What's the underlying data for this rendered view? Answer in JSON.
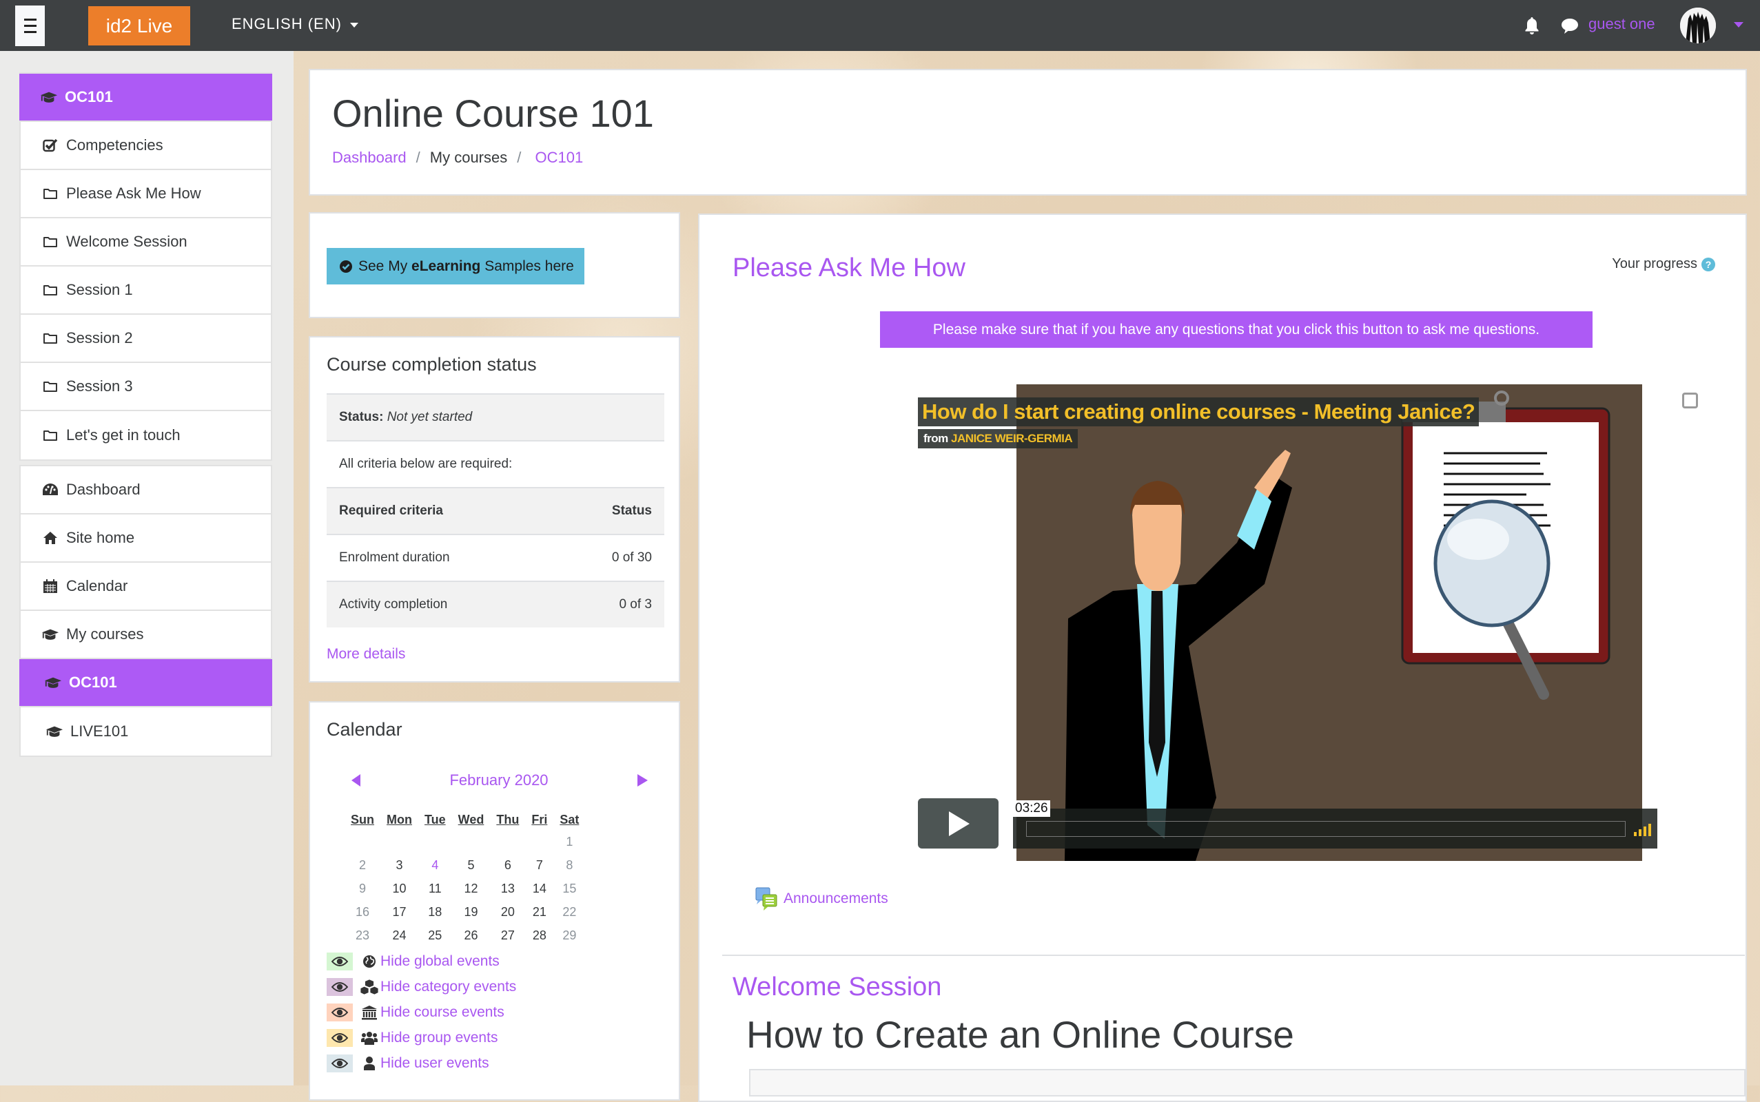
{
  "navbar": {
    "brand": "id2 Live",
    "language": "ENGLISH (EN)",
    "username": "guest one",
    "icons": [
      "menu-icon",
      "bell-icon",
      "chat-icon",
      "caret-down-icon"
    ]
  },
  "sidebar": {
    "course_nav": [
      {
        "label": "OC101",
        "icon": "graduation-cap-icon",
        "active": true
      },
      {
        "label": "Competencies",
        "icon": "checkbox-icon"
      },
      {
        "label": "Please Ask Me How",
        "icon": "folder-icon"
      },
      {
        "label": "Welcome Session",
        "icon": "folder-icon"
      },
      {
        "label": "Session 1",
        "icon": "folder-icon"
      },
      {
        "label": "Session 2",
        "icon": "folder-icon"
      },
      {
        "label": "Session 3",
        "icon": "folder-icon"
      },
      {
        "label": "Let's get in touch",
        "icon": "folder-icon"
      }
    ],
    "site_nav": [
      {
        "label": "Dashboard",
        "icon": "dashboard-icon"
      },
      {
        "label": "Site home",
        "icon": "home-icon"
      },
      {
        "label": "Calendar",
        "icon": "calendar-icon"
      },
      {
        "label": "My courses",
        "icon": "graduation-cap-icon"
      },
      {
        "label": "OC101",
        "icon": "graduation-cap-icon",
        "active": true
      },
      {
        "label": "LIVE101",
        "icon": "graduation-cap-icon"
      }
    ]
  },
  "header": {
    "title": "Online Course 101",
    "breadcrumb": [
      {
        "label": "Dashboard",
        "link": true
      },
      {
        "label": "My courses",
        "link": false
      },
      {
        "label": "OC101",
        "link": true
      }
    ]
  },
  "samples_block": {
    "button_prefix": "See My ",
    "button_bold": "eLearning",
    "button_suffix": " Samples here"
  },
  "completion": {
    "title": "Course completion status",
    "status_label": "Status:",
    "status_value": "Not yet started",
    "note": "All criteria below are required:",
    "col_criteria": "Required criteria",
    "col_status": "Status",
    "rows": [
      {
        "criteria": "Enrolment duration",
        "status": "0 of 30"
      },
      {
        "criteria": "Activity completion",
        "status": "0 of 3"
      }
    ],
    "more": "More details"
  },
  "calendar": {
    "title": "Calendar",
    "month": "February 2020",
    "weekdays": [
      "Sun",
      "Mon",
      "Tue",
      "Wed",
      "Thu",
      "Fri",
      "Sat"
    ],
    "weeks": [
      [
        "",
        "",
        "",
        "",
        "",
        "",
        "1"
      ],
      [
        "2",
        "3",
        "4",
        "5",
        "6",
        "7",
        "8"
      ],
      [
        "9",
        "10",
        "11",
        "12",
        "13",
        "14",
        "15"
      ],
      [
        "16",
        "17",
        "18",
        "19",
        "20",
        "21",
        "22"
      ],
      [
        "23",
        "24",
        "25",
        "26",
        "27",
        "28",
        "29"
      ]
    ],
    "today": "4",
    "event_filters": [
      {
        "label": "Hide global events",
        "icon": "globe-icon",
        "color": "#d5f6d2"
      },
      {
        "label": "Hide category events",
        "icon": "cubes-icon",
        "color": "#dbc3dd"
      },
      {
        "label": "Hide course events",
        "icon": "institution-icon",
        "color": "#ffd3bd"
      },
      {
        "label": "Hide group events",
        "icon": "group-icon",
        "color": "#fee7ae"
      },
      {
        "label": "Hide user events",
        "icon": "user-icon",
        "color": "#dce7ec"
      }
    ]
  },
  "main": {
    "section1_title": "Please Ask Me How",
    "progress_label": "Your progress",
    "ask_button": "Please make sure that if you have any questions that you click this button to ask me questions.",
    "video": {
      "title": "How do I start creating online courses - Meeting Janice?",
      "from_label": "from",
      "author": "JANICE WEIR-GERMIA",
      "time": "03:26"
    },
    "announcements": "Announcements",
    "section2_title": "Welcome Session",
    "section2_heading": "How to Create an Online Course"
  },
  "colors": {
    "accent": "#ad5af5",
    "link": "#a957f0",
    "brand": "#ec7e2a",
    "navbar": "#3e4143",
    "info_button": "#5fbcd9",
    "video_title": "#f2bf29"
  }
}
